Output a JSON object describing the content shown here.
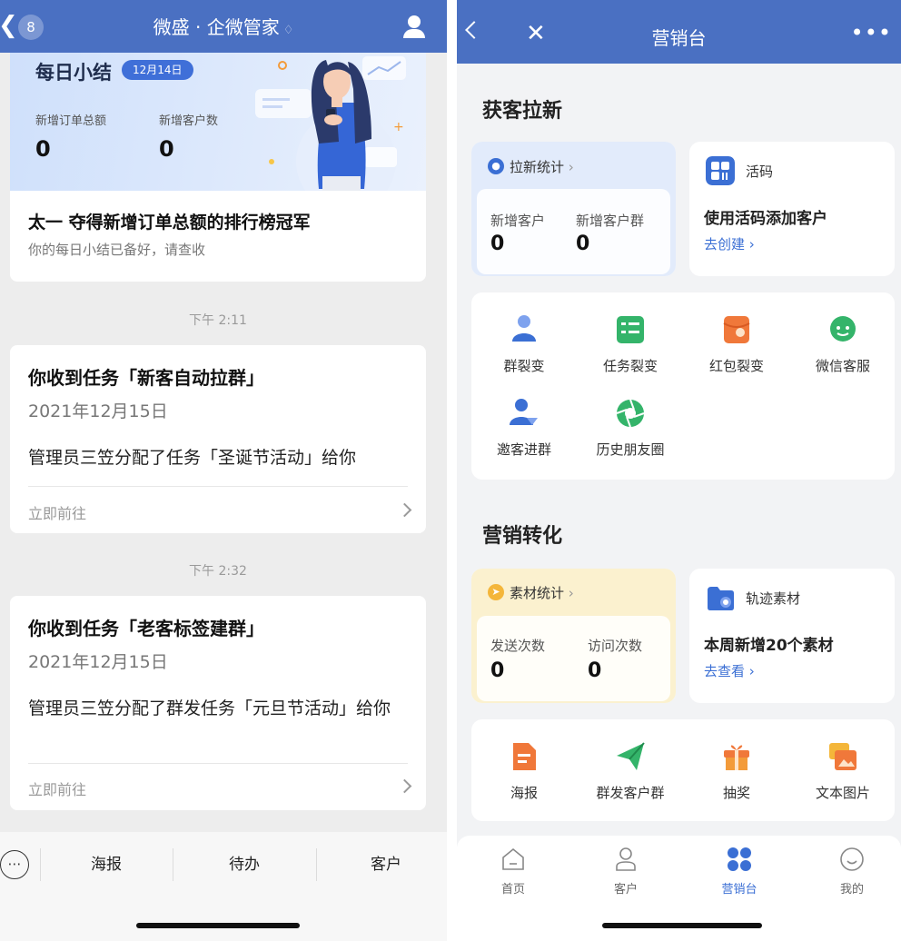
{
  "left": {
    "header": {
      "badge": "8",
      "title": "微盛 · 企微管家",
      "mute_icon": "bell-off-icon"
    },
    "summary": {
      "title": "每日小结",
      "date": "12月14日",
      "stats": [
        {
          "label": "新增订单总额",
          "value": "0"
        },
        {
          "label": "新增客户数",
          "value": "0"
        }
      ],
      "headline": "太一 夺得新增订单总额的排行榜冠军",
      "subtitle": "你的每日小结已备好，请查收"
    },
    "messages": [
      {
        "time": "下午 2:11",
        "title": "你收到任务「新客自动拉群」",
        "date": "2021年12月15日",
        "desc": "管理员三笠分配了任务「圣诞节活动」给你",
        "action": "立即前往"
      },
      {
        "time": "下午 2:32",
        "title": "你收到任务「老客标签建群」",
        "date": "2021年12月15日",
        "desc": "管理员三笠分配了群发任务「元旦节活动」给你",
        "action": "立即前往"
      }
    ],
    "bottom_bar": [
      "海报",
      "待办",
      "客户"
    ]
  },
  "right": {
    "header": {
      "title": "营销台",
      "more": "•••"
    },
    "acquire": {
      "title": "获客拉新",
      "stat_title": "拉新统计",
      "stats": [
        {
          "label": "新增客户",
          "value": "0"
        },
        {
          "label": "新增客户群",
          "value": "0"
        }
      ],
      "live_code": {
        "title": "活码",
        "text": "使用活码添加客户",
        "link": "去创建"
      },
      "grid": [
        {
          "label": "群裂变",
          "icon": "group-fission-icon"
        },
        {
          "label": "任务裂变",
          "icon": "task-fission-icon"
        },
        {
          "label": "红包裂变",
          "icon": "red-packet-icon"
        },
        {
          "label": "微信客服",
          "icon": "wechat-service-icon"
        },
        {
          "label": "邀客进群",
          "icon": "invite-group-icon"
        },
        {
          "label": "历史朋友圈",
          "icon": "moments-icon"
        }
      ]
    },
    "convert": {
      "title": "营销转化",
      "stat_title": "素材统计",
      "stats": [
        {
          "label": "发送次数",
          "value": "0"
        },
        {
          "label": "访问次数",
          "value": "0"
        }
      ],
      "track": {
        "title": "轨迹素材",
        "text": "本周新增20个素材",
        "link": "去查看"
      },
      "grid": [
        {
          "label": "海报",
          "icon": "poster-icon"
        },
        {
          "label": "群发客户群",
          "icon": "send-plane-icon"
        },
        {
          "label": "抽奖",
          "icon": "gift-icon"
        },
        {
          "label": "文本图片",
          "icon": "text-image-icon"
        }
      ]
    },
    "nav": [
      {
        "label": "首页",
        "icon": "home-icon"
      },
      {
        "label": "客户",
        "icon": "user-icon"
      },
      {
        "label": "营销台",
        "icon": "marketing-icon",
        "active": true
      },
      {
        "label": "我的",
        "icon": "smile-icon"
      }
    ],
    "colors": {
      "accent": "#3b6fd4",
      "header": "#4a70c2"
    }
  }
}
